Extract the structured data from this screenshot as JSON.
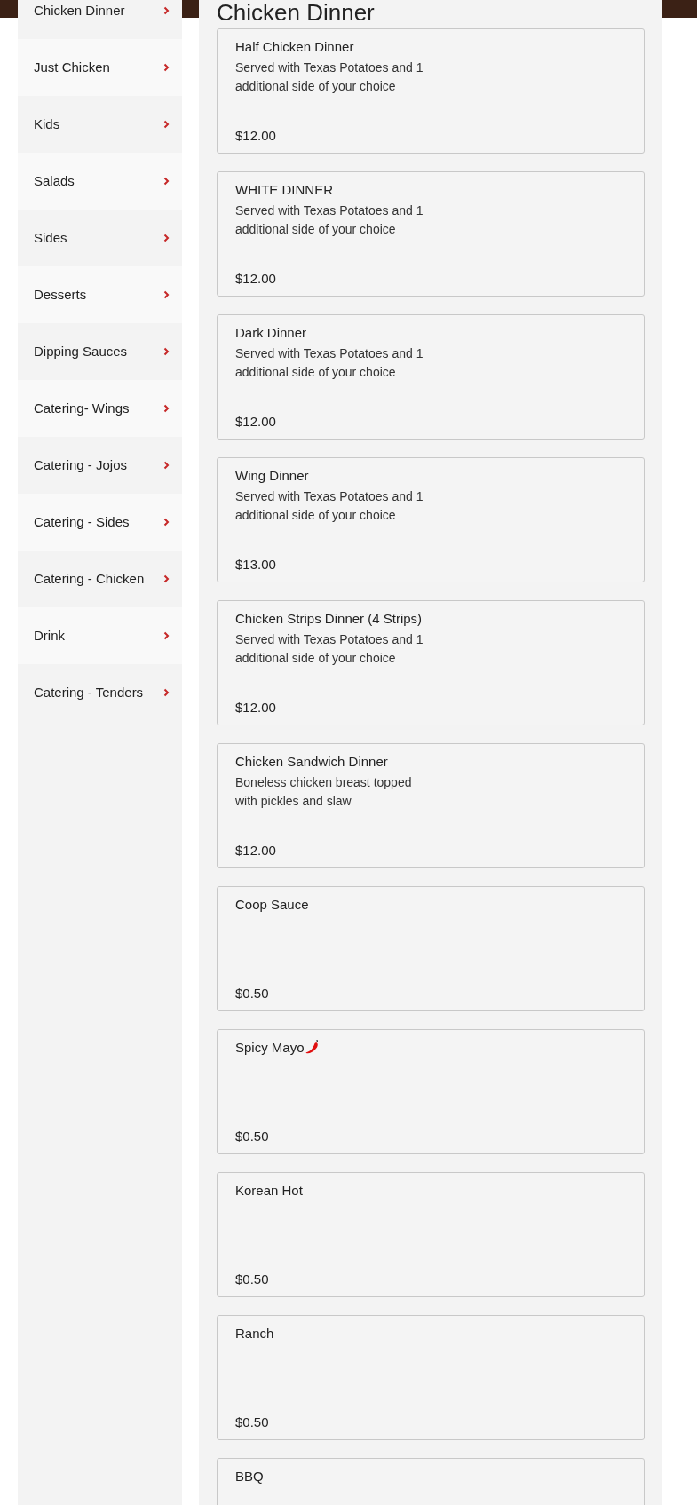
{
  "sidebar": {
    "items": [
      {
        "label": "Chicken Dinner",
        "selected": false
      },
      {
        "label": "Just Chicken",
        "selected": false
      },
      {
        "label": "Kids",
        "selected": false
      },
      {
        "label": "Salads",
        "selected": false
      },
      {
        "label": "Sides",
        "selected": false
      },
      {
        "label": "Desserts",
        "selected": false
      },
      {
        "label": "Dipping Sauces",
        "selected": false
      },
      {
        "label": "Catering- Wings",
        "selected": false
      },
      {
        "label": "Catering - Jojos",
        "selected": false
      },
      {
        "label": "Catering - Sides",
        "selected": false
      },
      {
        "label": "Catering - Chicken",
        "selected": false
      },
      {
        "label": "Drink",
        "selected": false
      },
      {
        "label": "Catering - Tenders",
        "selected": false
      }
    ]
  },
  "menu": {
    "heading": "Chicken Dinner",
    "items": [
      {
        "name": "Half Chicken Dinner",
        "description": "Served with Texas Potatoes and 1\nadditional side of your choice",
        "price": "$12.00",
        "spicy": false
      },
      {
        "name": "WHITE DINNER",
        "description": "Served with Texas Potatoes and 1\nadditional side of your choice",
        "price": "$12.00",
        "spicy": false
      },
      {
        "name": "Dark Dinner",
        "description": "Served with Texas Potatoes and 1\nadditional side of your choice",
        "price": "$12.00",
        "spicy": false
      },
      {
        "name": "Wing Dinner",
        "description": "Served with Texas Potatoes and 1\nadditional side of your choice",
        "price": "$13.00",
        "spicy": false
      },
      {
        "name": "Chicken Strips Dinner (4 Strips)",
        "description": "Served with Texas Potatoes and 1\nadditional side of your choice",
        "price": "$12.00",
        "spicy": false
      },
      {
        "name": "Chicken Sandwich Dinner",
        "description": "Boneless chicken breast topped\nwith pickles and slaw",
        "price": "$12.00",
        "spicy": false
      },
      {
        "name": "Coop Sauce",
        "price": "$0.50",
        "spicy": false
      },
      {
        "name": "Spicy Mayo",
        "price": "$0.50",
        "spicy": true
      },
      {
        "name": "Korean Hot",
        "price": "$0.50",
        "spicy": false
      },
      {
        "name": "Ranch",
        "price": "$0.50",
        "spicy": false
      },
      {
        "name": "BBQ",
        "spicy": false
      }
    ]
  }
}
